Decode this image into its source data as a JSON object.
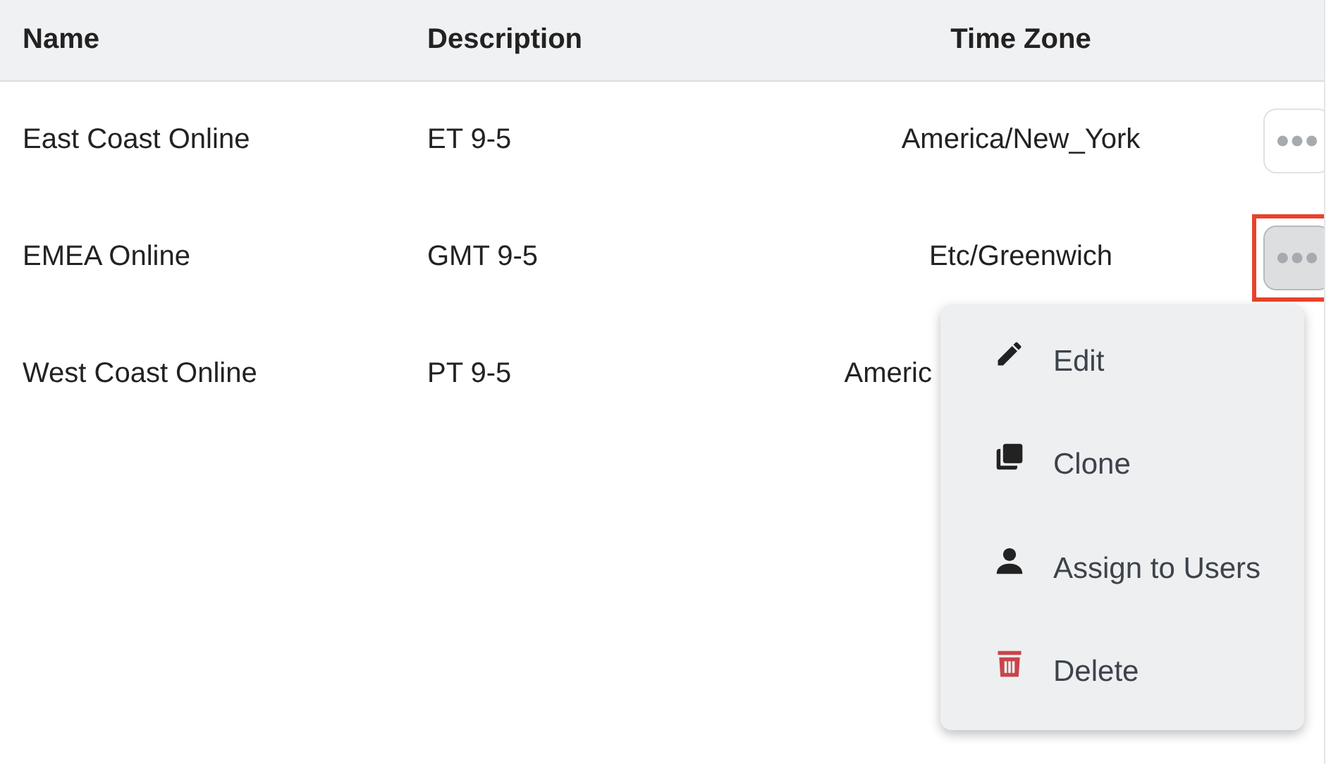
{
  "table": {
    "columns": [
      "Name",
      "Description",
      "Time Zone"
    ],
    "rows": [
      {
        "name": "East Coast Online",
        "description": "ET 9-5",
        "time_zone": "America/New_York",
        "menu_open": false,
        "highlighted": false
      },
      {
        "name": "EMEA Online",
        "description": "GMT 9-5",
        "time_zone": "Etc/Greenwich",
        "menu_open": true,
        "highlighted": true
      },
      {
        "name": "West Coast Online",
        "description": "PT 9-5",
        "time_zone": "Americ",
        "highlighted": false
      }
    ]
  },
  "menu": {
    "items": [
      {
        "kind": "edit",
        "label": "Edit"
      },
      {
        "kind": "clone",
        "label": "Clone"
      },
      {
        "kind": "user",
        "label": "Assign to Users"
      },
      {
        "kind": "delete",
        "label": "Delete"
      }
    ]
  }
}
